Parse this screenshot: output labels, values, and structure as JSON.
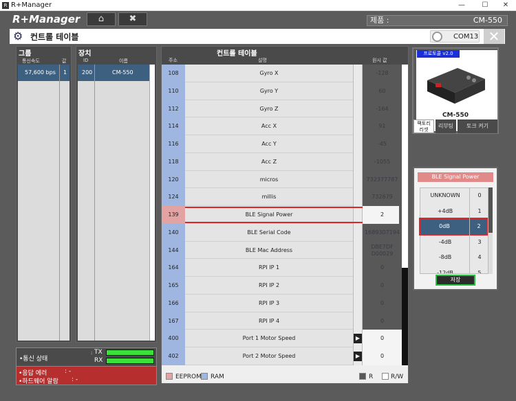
{
  "window": {
    "title": "R+Manager",
    "controls": {
      "minimize": "—",
      "maximize": "☐",
      "close": "✕"
    }
  },
  "brand": {
    "logo_text": "R+Manager"
  },
  "nav": {
    "home_label": "",
    "tools_label": ""
  },
  "product": {
    "label": "제품 :",
    "value": "CM-550"
  },
  "page": {
    "title": "컨트롤 테이블",
    "port": "COM13",
    "close_label": "✕"
  },
  "group": {
    "header": "그룹",
    "columns": [
      "통신속도",
      "값"
    ],
    "rows": [
      {
        "baud": "57,600 bps",
        "value": "1"
      }
    ]
  },
  "device": {
    "header": "장치",
    "columns": [
      "ID",
      "이름"
    ],
    "rows": [
      {
        "id": "200",
        "name": "CM-550"
      }
    ]
  },
  "control_table": {
    "header": "컨트롤 테이블",
    "columns": {
      "address": "주소",
      "description": "설명",
      "value": "원시 값"
    },
    "rows": [
      {
        "address": "108",
        "name": "Gyro X",
        "value": "-128"
      },
      {
        "address": "110",
        "name": "Gyro Y",
        "value": "60"
      },
      {
        "address": "112",
        "name": "Gyro Z",
        "value": "-164"
      },
      {
        "address": "114",
        "name": "Acc X",
        "value": "91"
      },
      {
        "address": "116",
        "name": "Acc Y",
        "value": "-45"
      },
      {
        "address": "118",
        "name": "Acc Z",
        "value": "-1055"
      },
      {
        "address": "120",
        "name": "micros",
        "value": "732377787"
      },
      {
        "address": "124",
        "name": "millis",
        "value": "732679"
      },
      {
        "address": "139",
        "name": "BLE Signal Power",
        "value": "2"
      },
      {
        "address": "140",
        "name": "BLE Serial Code",
        "value": "1689307194"
      },
      {
        "address": "144",
        "name": "BLE Mac Address",
        "value": "DBE7DF D00029"
      },
      {
        "address": "164",
        "name": "RPI IP 1",
        "value": "0"
      },
      {
        "address": "165",
        "name": "RPI IP 2",
        "value": "0"
      },
      {
        "address": "166",
        "name": "RPI IP 3",
        "value": "0"
      },
      {
        "address": "167",
        "name": "RPI IP 4",
        "value": "0"
      },
      {
        "address": "400",
        "name": "Port 1 Motor Speed",
        "value": "0"
      },
      {
        "address": "402",
        "name": "Port 2 Motor Speed",
        "value": "0"
      }
    ],
    "selected_address": "139",
    "legend": {
      "eeprom": "EEPROM",
      "ram": "RAM",
      "read": "R",
      "read_write": "R/W"
    }
  },
  "device_card": {
    "protocol": "프로토콜 v2.0",
    "name": "CM-550",
    "factory_reset": "팩토리\n리셋",
    "reboot": "리부팅",
    "torque_on": "토크 켜기"
  },
  "ble_panel": {
    "title": "BLE Signal Power",
    "options": [
      {
        "label": "UNKNOWN",
        "code": "0"
      },
      {
        "label": "+4dB",
        "code": "1"
      },
      {
        "label": "0dB",
        "code": "2"
      },
      {
        "label": "-4dB",
        "code": "3"
      },
      {
        "label": "-8dB",
        "code": "4"
      },
      {
        "label": "-12dB",
        "code": "5"
      }
    ],
    "selected_code": "2",
    "save_label": "저장"
  },
  "status": {
    "comm_label": "•통신 상태",
    "tx": "TX",
    "rx": "RX",
    "response_error": "•응답 에러",
    "response_error_value": ": -",
    "hardware_alarm": "•하드웨어 알람",
    "hardware_alarm_value": ": -"
  },
  "colors": {
    "eeprom": "#e4a3a3",
    "ram": "#9fb7e0",
    "selected": "#3d6080",
    "highlight": "#e0252a",
    "signal": "#39e139"
  }
}
